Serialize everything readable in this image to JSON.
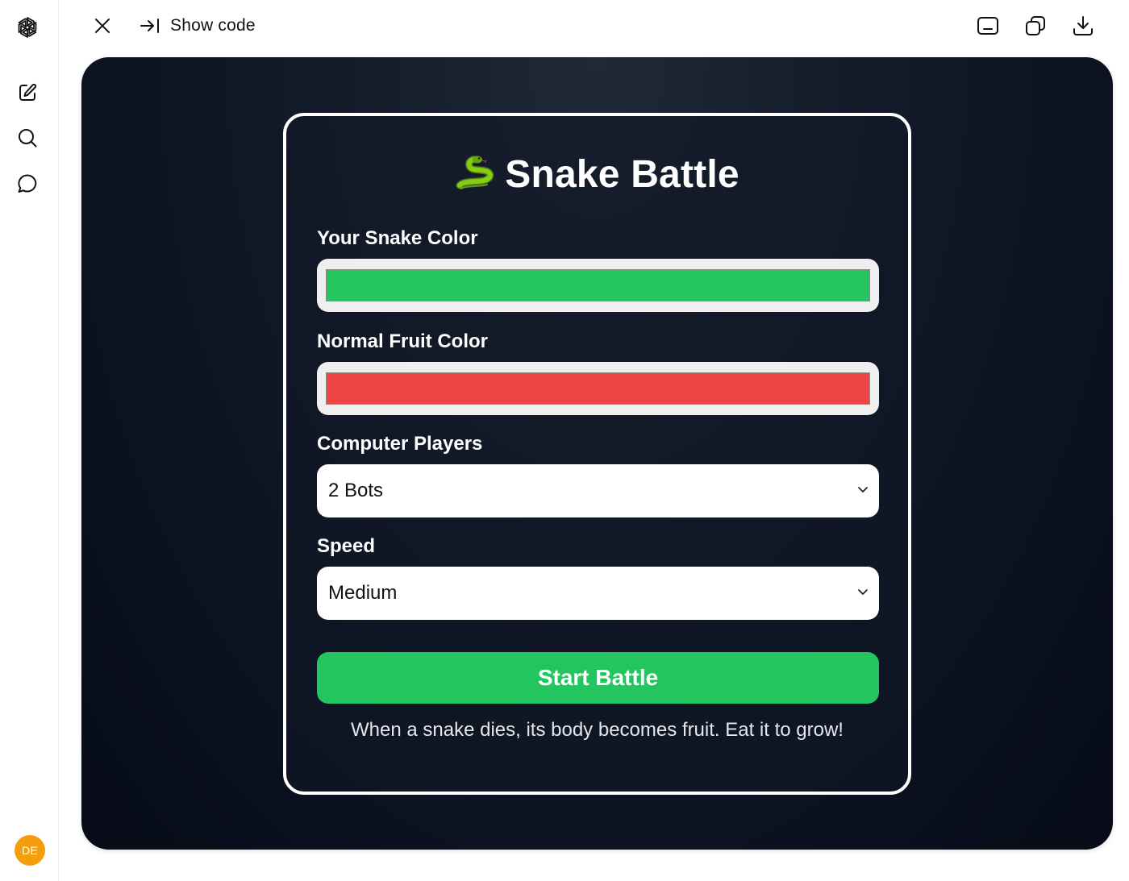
{
  "topbar": {
    "show_code_label": "Show code"
  },
  "user": {
    "avatar_initials": "DE",
    "avatar_color": "#f59e0b"
  },
  "game": {
    "title": "Snake Battle",
    "title_icon": "snake-emoji",
    "snake_color_label": "Your Snake Color",
    "snake_color_value": "#22c55e",
    "fruit_color_label": "Normal Fruit Color",
    "fruit_color_value": "#ef4444",
    "players_label": "Computer Players",
    "players_value": "2 Bots",
    "speed_label": "Speed",
    "speed_value": "Medium",
    "start_button": "Start Battle",
    "hint": "When a snake dies, its body becomes fruit. Eat it to grow!"
  },
  "colors": {
    "accent": "#22c55e",
    "canvas_bg": "#111827",
    "card_border": "#ffffff"
  }
}
